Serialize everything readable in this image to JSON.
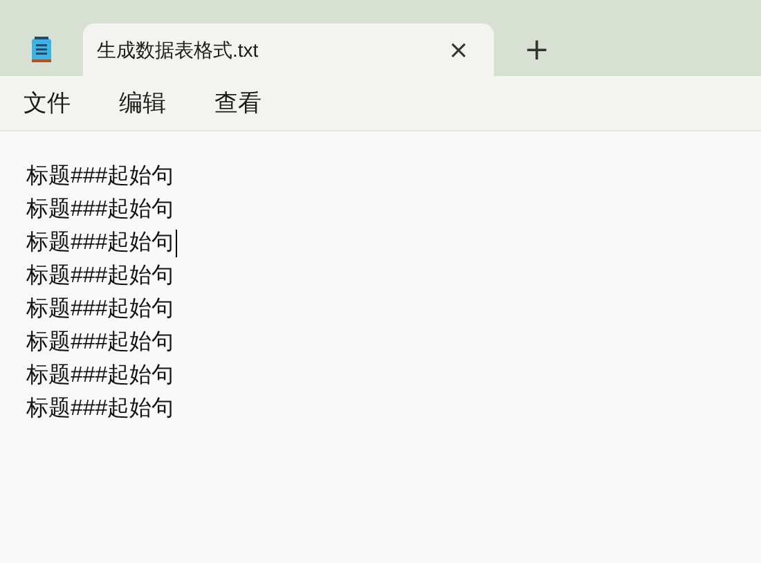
{
  "tabs": [
    {
      "label": "生成数据表格式.txt",
      "selected": true,
      "close": "×"
    }
  ],
  "new_tab": "+",
  "menu": [
    "文件",
    "编辑",
    "查看"
  ],
  "lines": [
    {
      "text": "标题###起始句",
      "caret": false
    },
    {
      "text": "标题###起始句",
      "caret": false
    },
    {
      "text": "标题###起始句",
      "caret": true
    },
    {
      "text": "标题###起始句",
      "caret": false
    },
    {
      "text": "标题###起始句",
      "caret": false
    },
    {
      "text": "标题###起始句",
      "caret": false
    },
    {
      "text": "标题###起始句",
      "caret": false
    },
    {
      "text": "标题###起始句",
      "caret": false
    }
  ]
}
